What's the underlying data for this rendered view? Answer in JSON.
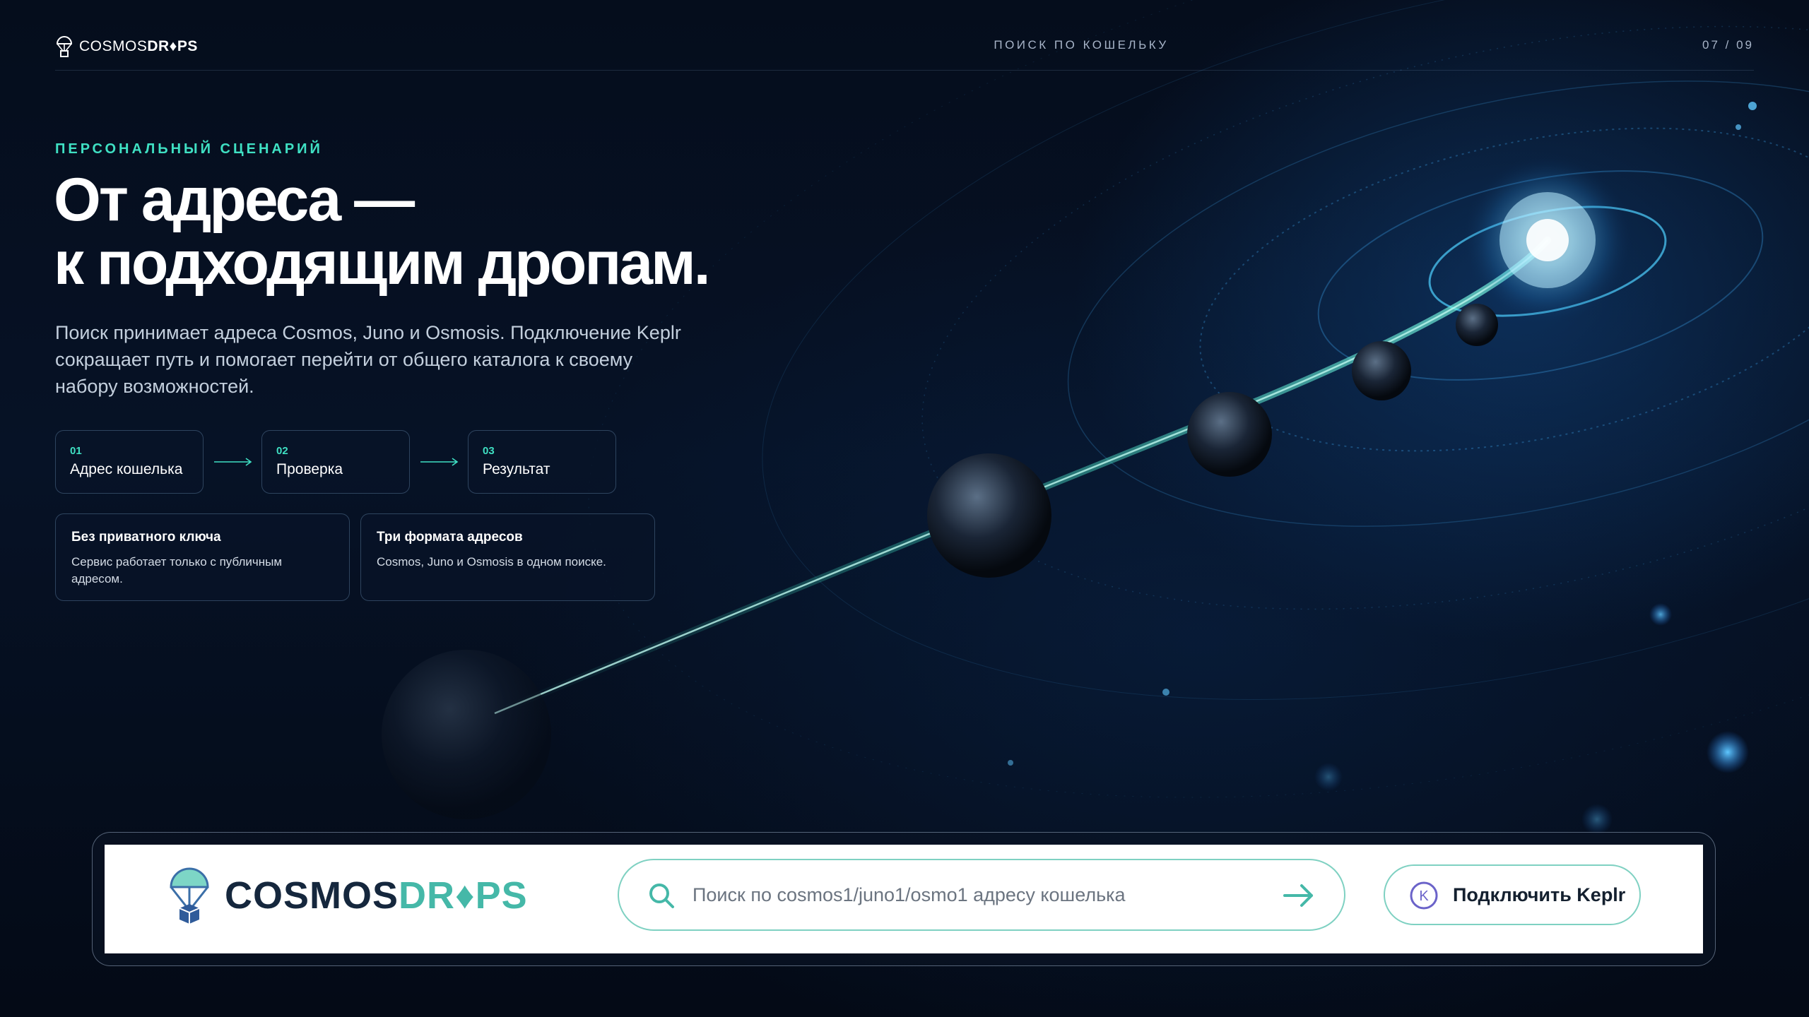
{
  "header": {
    "brand_light": "COSMOS",
    "brand_bold": "DR♦PS",
    "center_label": "ПОИСК ПО КОШЕЛЬКУ",
    "page_counter": "07 / 09"
  },
  "hero": {
    "eyebrow": "ПЕРСОНАЛЬНЫЙ СЦЕНАРИЙ",
    "headline_line1": "От адреса —",
    "headline_line2": "к подходящим дропам.",
    "lead": "Поиск принимает адреса Cosmos, Juno и Osmosis. Подключение Keplr сокращает путь и помогает перейти от общего каталога к своему набору возможностей."
  },
  "steps": [
    {
      "num": "01",
      "label": "Адрес кошелька"
    },
    {
      "num": "02",
      "label": "Проверка"
    },
    {
      "num": "03",
      "label": "Результат"
    }
  ],
  "cards": [
    {
      "title": "Без приватного ключа",
      "text": "Сервис работает только с публичным адресом."
    },
    {
      "title": "Три формата адресов",
      "text": "Cosmos, Juno и Osmosis в одном поиске."
    }
  ],
  "bar": {
    "logo_part1": "COSMOS",
    "logo_part2": "DR♦PS",
    "search_placeholder": "Поиск по cosmos1/juno1/osmo1 адресу кошелька",
    "keplr_label": "Подключить Keplr",
    "keplr_icon_letter": "K"
  },
  "colors": {
    "accent": "#3fe0c3",
    "background": "#040b18",
    "bar_border": "#7fd1c2",
    "logo_dark": "#15273d",
    "logo_teal": "#45b8a8"
  },
  "icons": {
    "brand": "parachute-drop-icon",
    "search": "search-icon",
    "submit": "arrow-right-icon",
    "keplr": "keplr-k-icon"
  }
}
